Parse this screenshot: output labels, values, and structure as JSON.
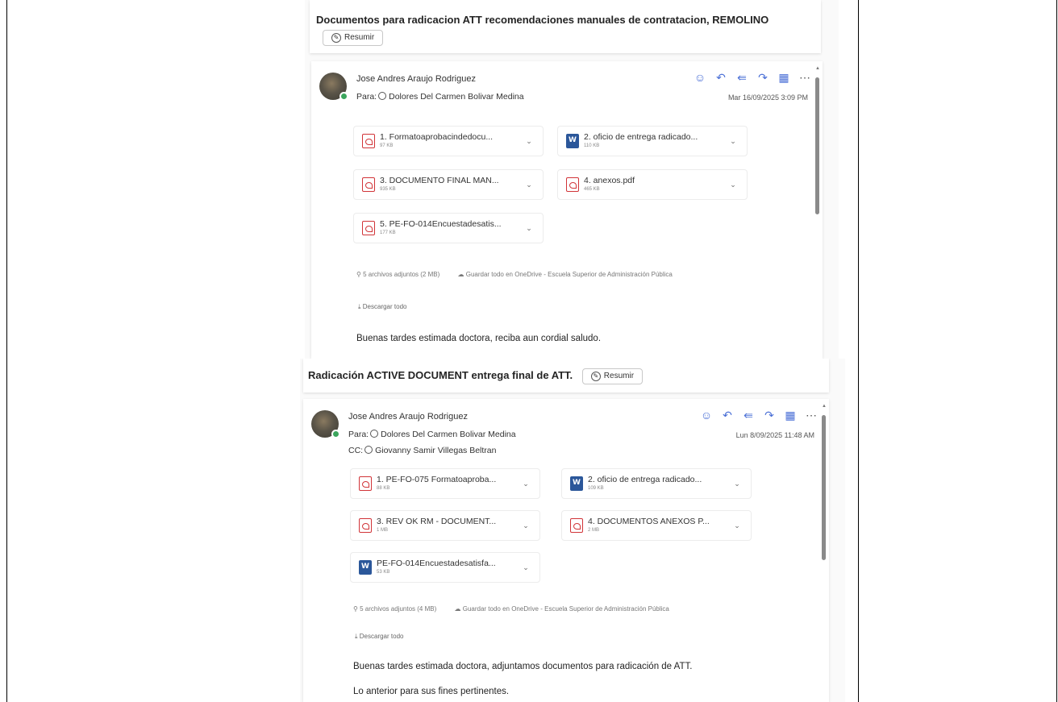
{
  "corner_text": "…………………………………",
  "summarize_label": "Resumir",
  "emails": [
    {
      "subject": "Documentos para radicacion ATT recomendaciones manuales de contratacion, REMOLINO",
      "sender": "Jose Andres Araujo Rodriguez",
      "to_label": "Para:",
      "to": "Dolores Del Carmen Bolivar Medina",
      "cc_label": "",
      "cc": "",
      "date": "Mar 16/09/2025 3:09 PM",
      "attachments": [
        {
          "name": "1. Formatoaprobacindedocu...",
          "size": "97 KB",
          "type": "pdf"
        },
        {
          "name": "2. oficio de entrega radicado...",
          "size": "110 KB",
          "type": "doc"
        },
        {
          "name": "3. DOCUMENTO FINAL MAN...",
          "size": "935 KB",
          "type": "pdf"
        },
        {
          "name": "4. anexos.pdf",
          "size": "465 KB",
          "type": "pdf"
        },
        {
          "name": "5. PE-FO-014Encuestadesatis...",
          "size": "177 KB",
          "type": "pdf"
        }
      ],
      "attach_summary": "5 archivos adjuntos (2 MB)",
      "save_onedrive": "Guardar todo en OneDrive - Escuela Superior de Administración Pública",
      "download_all": "Descargar todo",
      "body_lines": [
        "Buenas tardes estimada doctora, reciba aun cordial saludo."
      ]
    },
    {
      "subject": "Radicación ACTIVE DOCUMENT entrega final de ATT.",
      "sender": "Jose Andres Araujo Rodriguez",
      "to_label": "Para:",
      "to": "Dolores Del Carmen Bolivar Medina",
      "cc_label": "CC:",
      "cc": "Giovanny Samir Villegas Beltran",
      "date": "Lun 8/09/2025 11:48 AM",
      "attachments": [
        {
          "name": "1. PE-FO-075 Formatoaproba...",
          "size": "88 KB",
          "type": "pdf"
        },
        {
          "name": "2. oficio de entrega radicado...",
          "size": "109 KB",
          "type": "doc"
        },
        {
          "name": "3. REV OK RM - DOCUMENT...",
          "size": "1 MB",
          "type": "pdf"
        },
        {
          "name": "4. DOCUMENTOS ANEXOS P...",
          "size": "2 MB",
          "type": "pdf"
        },
        {
          "name": "PE-FO-014Encuestadesatisfa...",
          "size": "53 KB",
          "type": "doc"
        }
      ],
      "attach_summary": "5 archivos adjuntos (4 MB)",
      "save_onedrive": "Guardar todo en OneDrive - Escuela Superior de Administración Pública",
      "download_all": "Descargar todo",
      "body_lines": [
        "Buenas tardes estimada doctora, adjuntamos documentos para radicación de ATT.",
        "Lo anterior para sus fines pertinentes."
      ]
    }
  ]
}
